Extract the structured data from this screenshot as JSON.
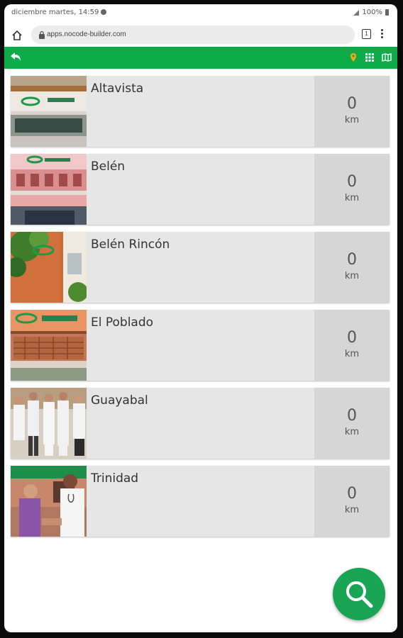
{
  "status_bar": {
    "datetime": "diciembre martes, 14:59",
    "battery": "100%"
  },
  "browser": {
    "url": "apps.nocode-builder.com",
    "tabs_count": "1"
  },
  "toolbar": {
    "background_color": "#0eac48",
    "icons": [
      "back-arrow-icon",
      "location-pin-icon",
      "grid-icon",
      "map-icon"
    ]
  },
  "locations": [
    {
      "name": "Altavista",
      "distance": "0",
      "unit": "km"
    },
    {
      "name": "Belén",
      "distance": "0",
      "unit": "km"
    },
    {
      "name": "Belén Rincón",
      "distance": "0",
      "unit": "km"
    },
    {
      "name": "El Poblado",
      "distance": "0",
      "unit": "km"
    },
    {
      "name": "Guayabal",
      "distance": "0",
      "unit": "km"
    },
    {
      "name": "Trinidad",
      "distance": "0",
      "unit": "km"
    }
  ],
  "fab": {
    "icon": "search-icon",
    "color": "#1aa554"
  }
}
